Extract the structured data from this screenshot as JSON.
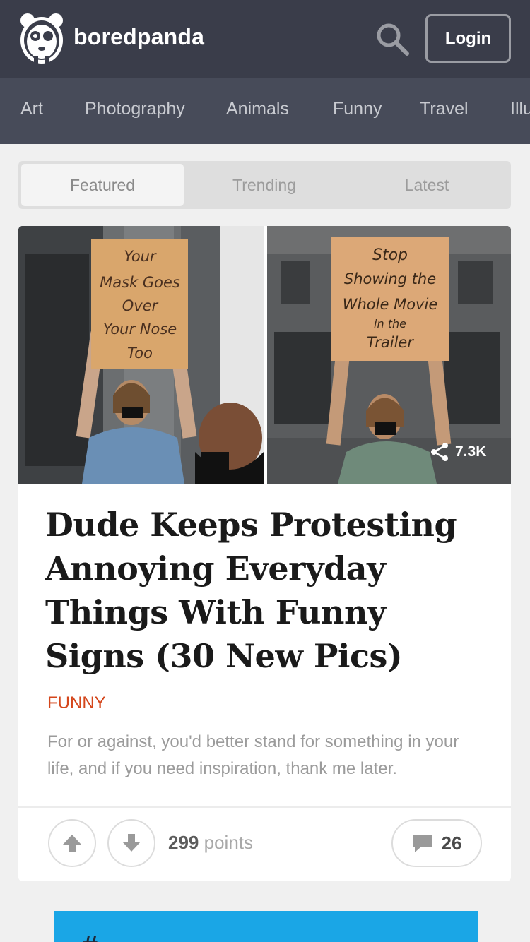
{
  "header": {
    "brand": "boredpanda",
    "login_label": "Login",
    "icons": {
      "logo": "panda-logo-icon",
      "search": "search-icon"
    }
  },
  "categories": [
    "Art",
    "Photography",
    "Animals",
    "Funny",
    "Travel",
    "Illu"
  ],
  "tabs": [
    {
      "label": "Featured",
      "active": true
    },
    {
      "label": "Trending",
      "active": false
    },
    {
      "label": "Latest",
      "active": false
    }
  ],
  "article": {
    "images": {
      "left_sign_text": [
        "Your",
        "Mask Goes",
        "Over",
        "Your Nose",
        "Too"
      ],
      "right_sign_text": [
        "Stop",
        "Showing the",
        "Whole Movie",
        "in the",
        "Trailer"
      ]
    },
    "shares": "7.3K",
    "title": "Dude Keeps Protesting Annoying Everyday Things With Funny Signs (30 New Pics)",
    "category": "FUNNY",
    "excerpt": "For or against, you'd better stand for something in your life, and if you need inspiration, thank me later.",
    "points_value": "299",
    "points_label": "points",
    "comments_count": "26",
    "icons": {
      "share": "share-icon",
      "upvote": "arrow-up-icon",
      "downvote": "arrow-down-icon",
      "comment": "comment-bubble-icon"
    }
  },
  "colors": {
    "header_bg": "#3a3d4a",
    "nav_bg": "#474b59",
    "category_accent": "#d4461b",
    "ad_bg": "#1aa6e6"
  },
  "ad": {
    "visible_text": "#"
  }
}
